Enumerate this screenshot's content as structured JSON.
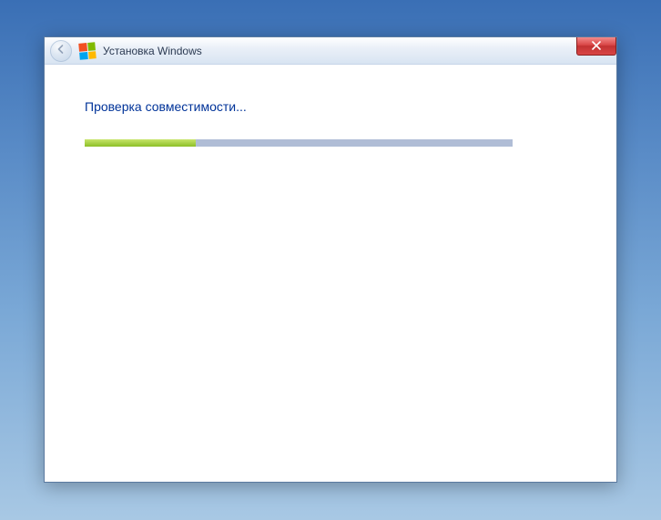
{
  "window": {
    "title": "Установка Windows"
  },
  "content": {
    "heading": "Проверка совместимости..."
  },
  "progress": {
    "percent": 26
  },
  "colors": {
    "accent": "#003399",
    "progress_fill": "#8cbf26",
    "progress_track": "#b0bdd6",
    "close_button": "#d94545"
  },
  "icons": {
    "back": "arrow-left-icon",
    "logo": "windows-flag-icon",
    "close": "close-x-icon"
  }
}
